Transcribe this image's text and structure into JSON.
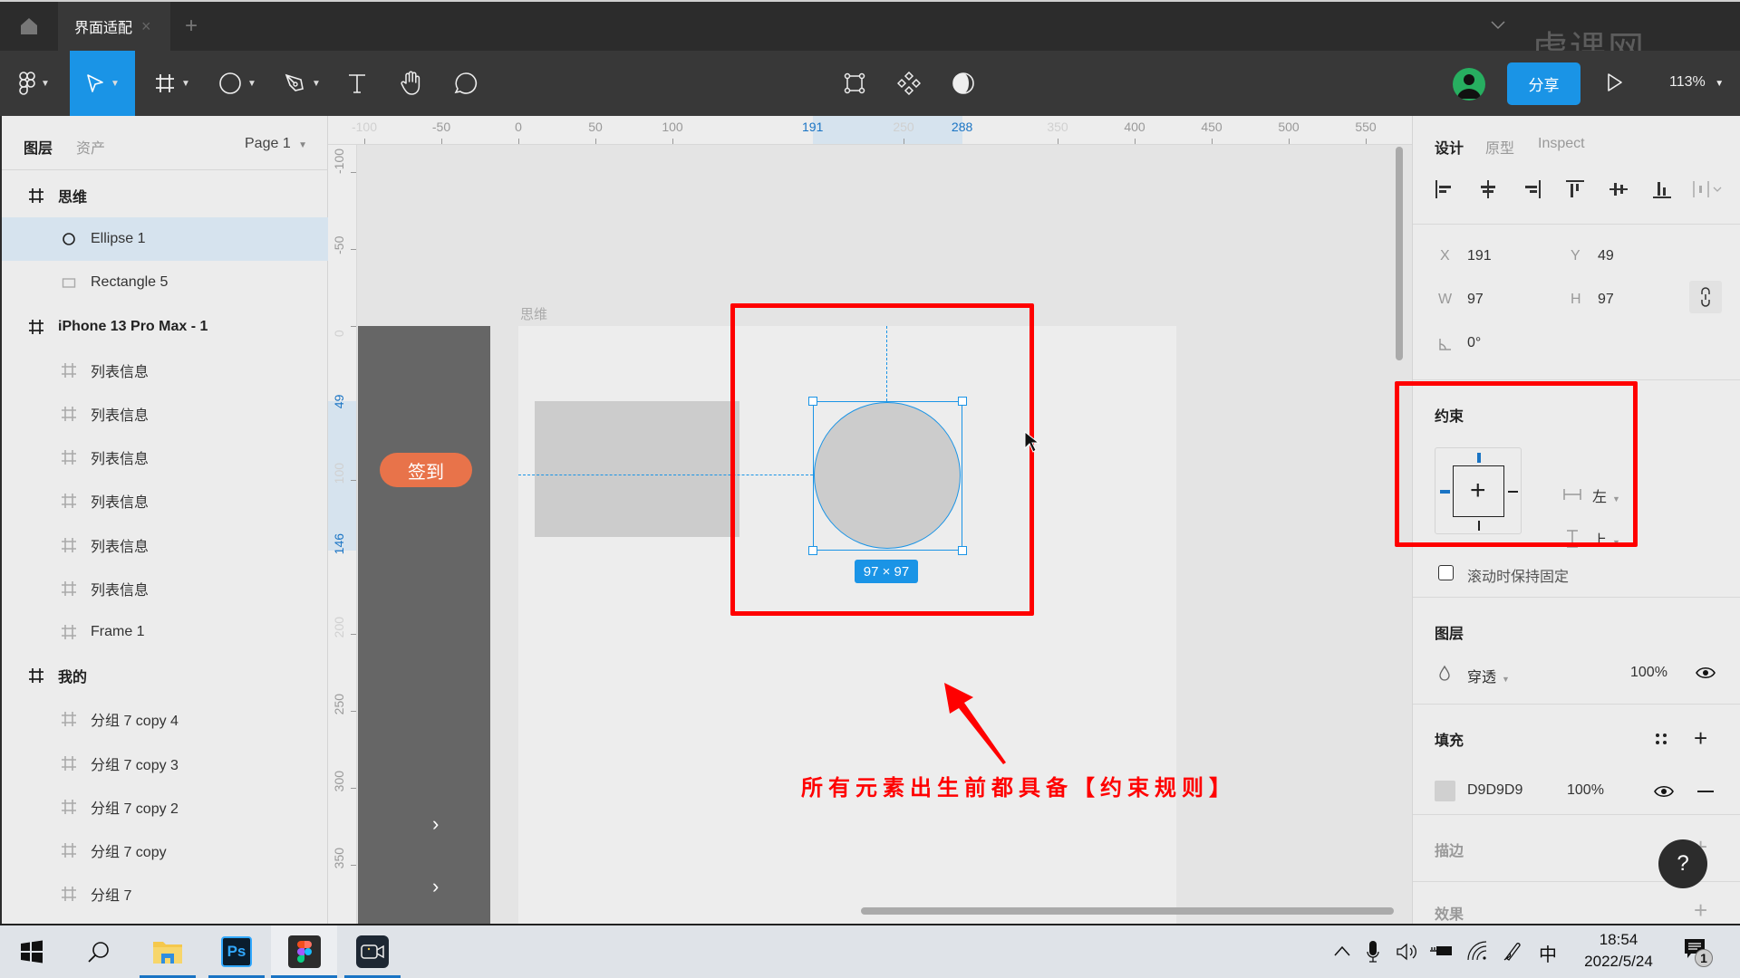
{
  "app": {
    "file_tab": "界面适配",
    "watermark": "虎课网",
    "zoom_level": "113%",
    "share_label": "分享"
  },
  "toolbar": {
    "tools": [
      {
        "name": "main-menu",
        "icon": "figma-logo-icon"
      },
      {
        "name": "move-tool",
        "icon": "cursor-icon",
        "active": true
      },
      {
        "name": "frame-tool",
        "icon": "hash-icon"
      },
      {
        "name": "ellipse-tool",
        "icon": "circle-icon"
      },
      {
        "name": "pen-tool",
        "icon": "pen-icon"
      },
      {
        "name": "text-tool",
        "icon": "text-icon",
        "glyph": "T"
      },
      {
        "name": "hand-tool",
        "icon": "hand-icon"
      },
      {
        "name": "comment-tool",
        "icon": "comment-icon"
      }
    ],
    "center_tools": [
      "edit-object-icon",
      "component-icon",
      "contrast-icon"
    ]
  },
  "left_panel": {
    "tabs": {
      "layers": "图层",
      "assets": "资产"
    },
    "page_selector": "Page 1",
    "layers": [
      {
        "label": "思维",
        "type": "frame",
        "level": 0
      },
      {
        "label": "Ellipse 1",
        "type": "ellipse",
        "level": 1,
        "selected": true
      },
      {
        "label": "Rectangle 5",
        "type": "rectangle",
        "level": 1
      },
      {
        "label": "iPhone 13 Pro Max - 1",
        "type": "frame",
        "level": 0
      },
      {
        "label": "列表信息",
        "type": "frame",
        "level": 1
      },
      {
        "label": "列表信息",
        "type": "frame",
        "level": 1
      },
      {
        "label": "列表信息",
        "type": "frame",
        "level": 1
      },
      {
        "label": "列表信息",
        "type": "frame",
        "level": 1
      },
      {
        "label": "列表信息",
        "type": "frame",
        "level": 1
      },
      {
        "label": "列表信息",
        "type": "frame",
        "level": 1
      },
      {
        "label": "Frame 1",
        "type": "frame",
        "level": 1
      },
      {
        "label": "我的",
        "type": "frame",
        "level": 0
      },
      {
        "label": "分组 7 copy 4",
        "type": "frame",
        "level": 1
      },
      {
        "label": "分组 7 copy 3",
        "type": "frame",
        "level": 1
      },
      {
        "label": "分组 7 copy 2",
        "type": "frame",
        "level": 1
      },
      {
        "label": "分组 7 copy",
        "type": "frame",
        "level": 1
      },
      {
        "label": "分组 7",
        "type": "frame",
        "level": 1
      }
    ]
  },
  "rulers": {
    "top": [
      {
        "v": "-100",
        "faded": true
      },
      {
        "v": "-50"
      },
      {
        "v": "0"
      },
      {
        "v": "50"
      },
      {
        "v": "100"
      },
      {
        "v": "191",
        "highlight": true
      },
      {
        "v": "250",
        "faded": true
      },
      {
        "v": "288",
        "highlight": true
      },
      {
        "v": "350",
        "faded": true
      },
      {
        "v": "400"
      },
      {
        "v": "450"
      },
      {
        "v": "500"
      },
      {
        "v": "550"
      }
    ],
    "left": [
      {
        "v": "-100"
      },
      {
        "v": "-50"
      },
      {
        "v": "0",
        "faded": true
      },
      {
        "v": "49",
        "highlight": true
      },
      {
        "v": "100",
        "faded": true
      },
      {
        "v": "146",
        "highlight": true
      },
      {
        "v": "200",
        "faded": true
      },
      {
        "v": "250"
      },
      {
        "v": "300"
      },
      {
        "v": "350"
      }
    ]
  },
  "canvas": {
    "frame_label": "思维",
    "checkin_button": "签到",
    "size_badge": "97 × 97",
    "annotation": "所有元素出生前都具备【约束规则】",
    "annotation_color": "#ff0000",
    "selection_color": "#1a94e6"
  },
  "right_panel": {
    "tabs": {
      "design": "设计",
      "prototype": "原型",
      "inspect": "Inspect"
    },
    "position": {
      "x_label": "X",
      "x": "191",
      "y_label": "Y",
      "y": "49"
    },
    "size": {
      "w_label": "W",
      "w": "97",
      "h_label": "H",
      "h": "97"
    },
    "rotation": "0°",
    "constraints": {
      "title": "约束",
      "horizontal": "左",
      "vertical": "上",
      "fixed_on_scroll": "滚动时保持固定",
      "fixed_on_scroll_checked": false
    },
    "layer": {
      "title": "图层",
      "blend": "穿透",
      "opacity": "100%"
    },
    "fill": {
      "title": "填充",
      "hex": "D9D9D9",
      "opacity": "100%",
      "swatch": "#d9d9d9"
    },
    "stroke": {
      "title": "描边"
    },
    "effects": {
      "title": "效果"
    },
    "help": "?"
  },
  "taskbar": {
    "apps": [
      "start-icon",
      "search-icon",
      "file-explorer-icon",
      "photoshop-icon",
      "figma-icon",
      "camera-app-icon"
    ],
    "ps_label": "Ps",
    "ime": "中",
    "time": "18:54",
    "date": "2022/5/24",
    "notification_count": "1"
  }
}
